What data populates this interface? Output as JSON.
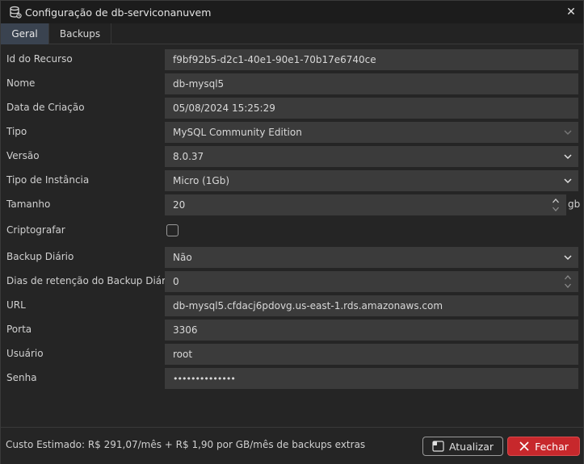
{
  "window": {
    "title": "Configuração de db-serviconanuvem",
    "close_symbol": "✕",
    "icon": "database-icon"
  },
  "tabs": [
    {
      "label": "Geral",
      "active": true
    },
    {
      "label": "Backups",
      "active": false
    }
  ],
  "fields": {
    "resource_id": {
      "label": "Id do Recurso",
      "value": "f9bf92b5-d2c1-40e1-90e1-70b17e6740ce"
    },
    "name": {
      "label": "Nome",
      "value": "db-mysql5"
    },
    "created": {
      "label": "Data de Criação",
      "value": "05/08/2024 15:25:29"
    },
    "type": {
      "label": "Tipo",
      "value": "MySQL Community Edition"
    },
    "version": {
      "label": "Versão",
      "value": "8.0.37"
    },
    "instance_type": {
      "label": "Tipo de Instância",
      "value": "Micro (1Gb)"
    },
    "size": {
      "label": "Tamanho",
      "value": "20",
      "unit": "gb"
    },
    "encrypt": {
      "label": "Criptografar",
      "checked": false
    },
    "daily_backup": {
      "label": "Backup Diário",
      "value": "Não"
    },
    "retention": {
      "label": "Dias de retenção do Backup Diário",
      "value": "0"
    },
    "url": {
      "label": "URL",
      "value": "db-mysql5.cfdacj6pdovg.us-east-1.rds.amazonaws.com"
    },
    "port": {
      "label": "Porta",
      "value": "3306"
    },
    "user": {
      "label": "Usuário",
      "value": "root"
    },
    "password": {
      "label": "Senha",
      "value": "••••••••••••••"
    }
  },
  "footer": {
    "cost_label": "Custo Estimado:",
    "cost_value": "R$ 291,07/mês + R$ 1,90 por GB/mês de backups extras",
    "update_label": "Atualizar",
    "close_label": "Fechar"
  },
  "colors": {
    "accent_tab": "#3a4350",
    "close_button": "#c7282c",
    "field_bg": "#3b3b3b"
  }
}
